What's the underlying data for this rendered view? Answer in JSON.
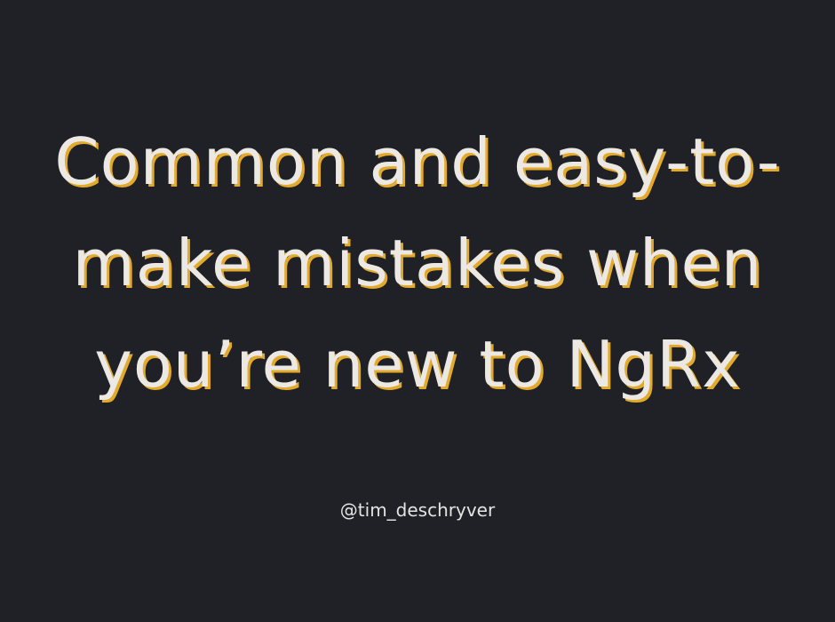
{
  "slide": {
    "title_lines": [
      "Common and easy-to-",
      "make mistakes when",
      "you’re new to NgRx"
    ],
    "handle": "@tim_deschryver"
  },
  "colors": {
    "background": "#1f2127",
    "title_text": "#ece9e4",
    "title_shadow": "#e3a92a",
    "handle_text": "#e4e4e4"
  }
}
